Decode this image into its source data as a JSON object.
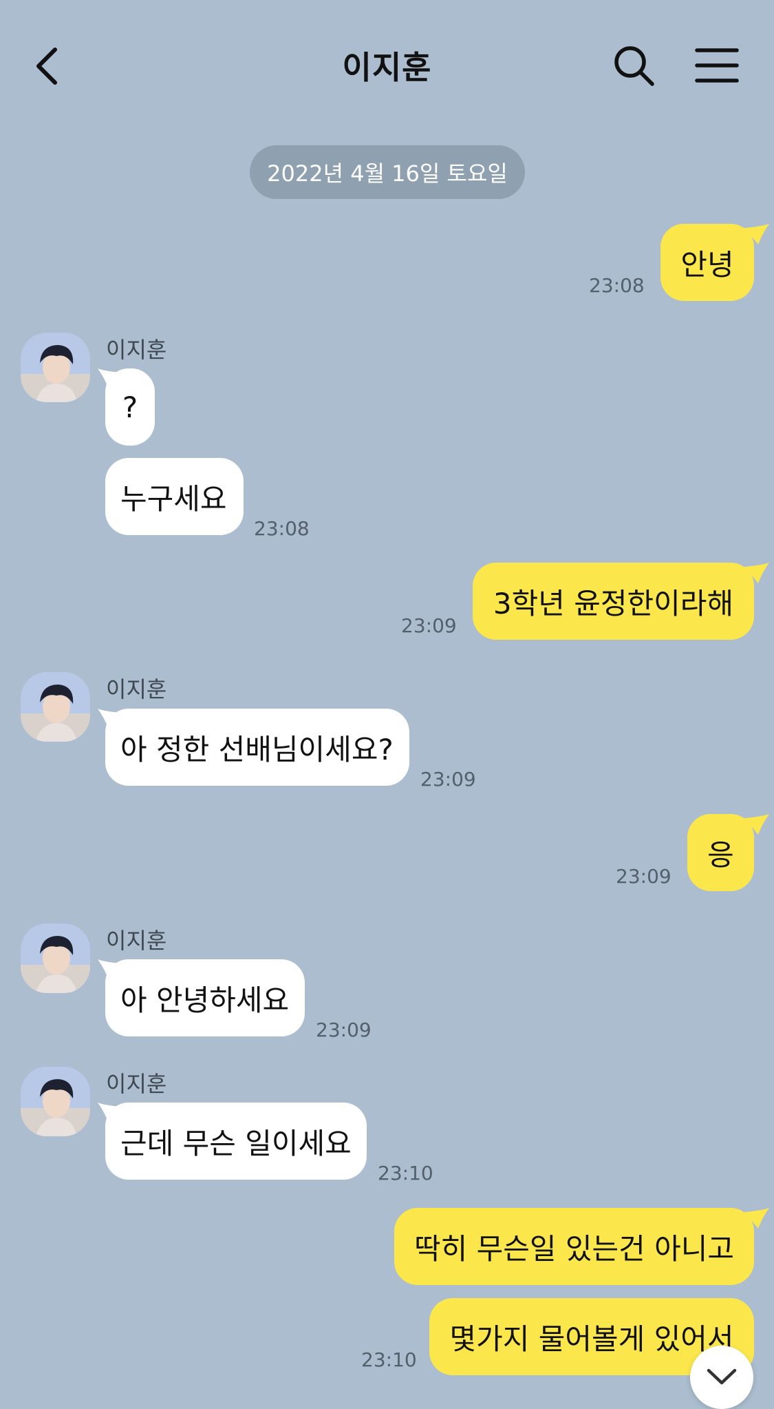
{
  "header": {
    "title": "이지훈",
    "back_icon": "chevron-left-icon",
    "search_icon": "search-icon",
    "menu_icon": "hamburger-menu-icon"
  },
  "date_divider": "2022년 4월 16일 토요일",
  "colors": {
    "background": "#abbdce",
    "my_bubble": "#fbe74c",
    "their_bubble": "#ffffff",
    "date_pill": "#8fa0b0"
  },
  "messages": [
    {
      "from": "me",
      "text": "안녕",
      "time": "23:08"
    },
    {
      "from": "other",
      "sender": "이지훈",
      "text": "?",
      "time": ""
    },
    {
      "from": "other",
      "text": "누구세요",
      "time": "23:08"
    },
    {
      "from": "me",
      "text": "3학년 윤정한이라해",
      "time": "23:09"
    },
    {
      "from": "other",
      "sender": "이지훈",
      "text": "아 정한 선배님이세요?",
      "time": "23:09"
    },
    {
      "from": "me",
      "text": "응",
      "time": "23:09"
    },
    {
      "from": "other",
      "sender": "이지훈",
      "text": "아 안녕하세요",
      "time": "23:09"
    },
    {
      "from": "other",
      "sender": "이지훈",
      "text": "근데 무슨 일이세요",
      "time": "23:10"
    },
    {
      "from": "me",
      "text": "딱히 무슨일 있는건 아니고",
      "time": ""
    },
    {
      "from": "me",
      "text": "몇가지 물어볼게 있어서",
      "time": "23:10"
    }
  ],
  "scroll_down_icon": "chevron-down-icon"
}
